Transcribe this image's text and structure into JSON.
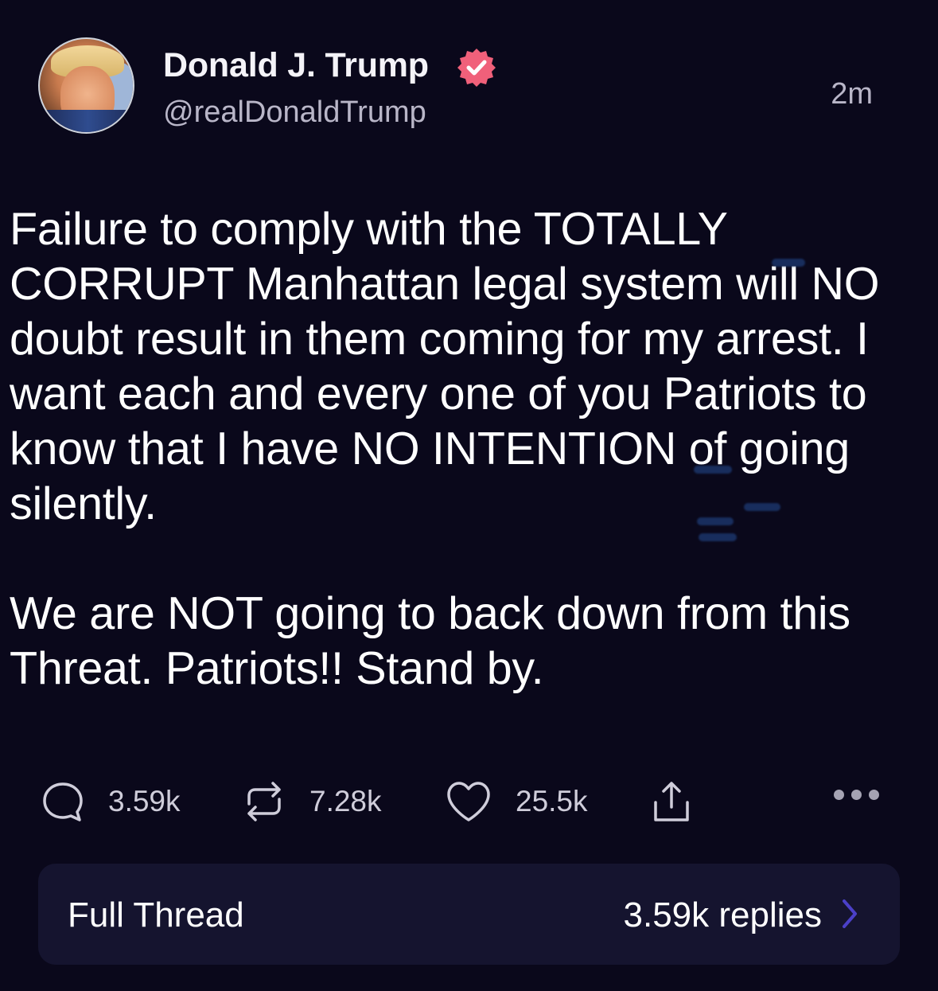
{
  "author": {
    "display_name": "Donald J. Trump",
    "handle": "@realDonaldTrump",
    "verified": true,
    "verified_color": "#f0607a"
  },
  "timestamp": "2m",
  "post": {
    "paragraphs": [
      "Failure to comply with the TOTALLY CORRUPT Manhattan legal system will NO doubt result in them coming for my arrest. I want each and every one of you Patriots to know that I have NO INTENTION of going silently.",
      "We are NOT going to back down from this Threat. Patriots!! Stand by."
    ]
  },
  "actions": {
    "replies": "3.59k",
    "reposts": "7.28k",
    "likes": "25.5k",
    "icons": [
      "reply-icon",
      "repost-icon",
      "heart-icon",
      "share-icon",
      "more-icon"
    ]
  },
  "thread": {
    "label": "Full Thread",
    "replies_text": "3.59k replies",
    "chevron_color": "#4b40c8"
  },
  "colors": {
    "background": "#0a081b",
    "card": "#15142f",
    "text": "#ffffff",
    "muted": "#b9b6c8"
  }
}
